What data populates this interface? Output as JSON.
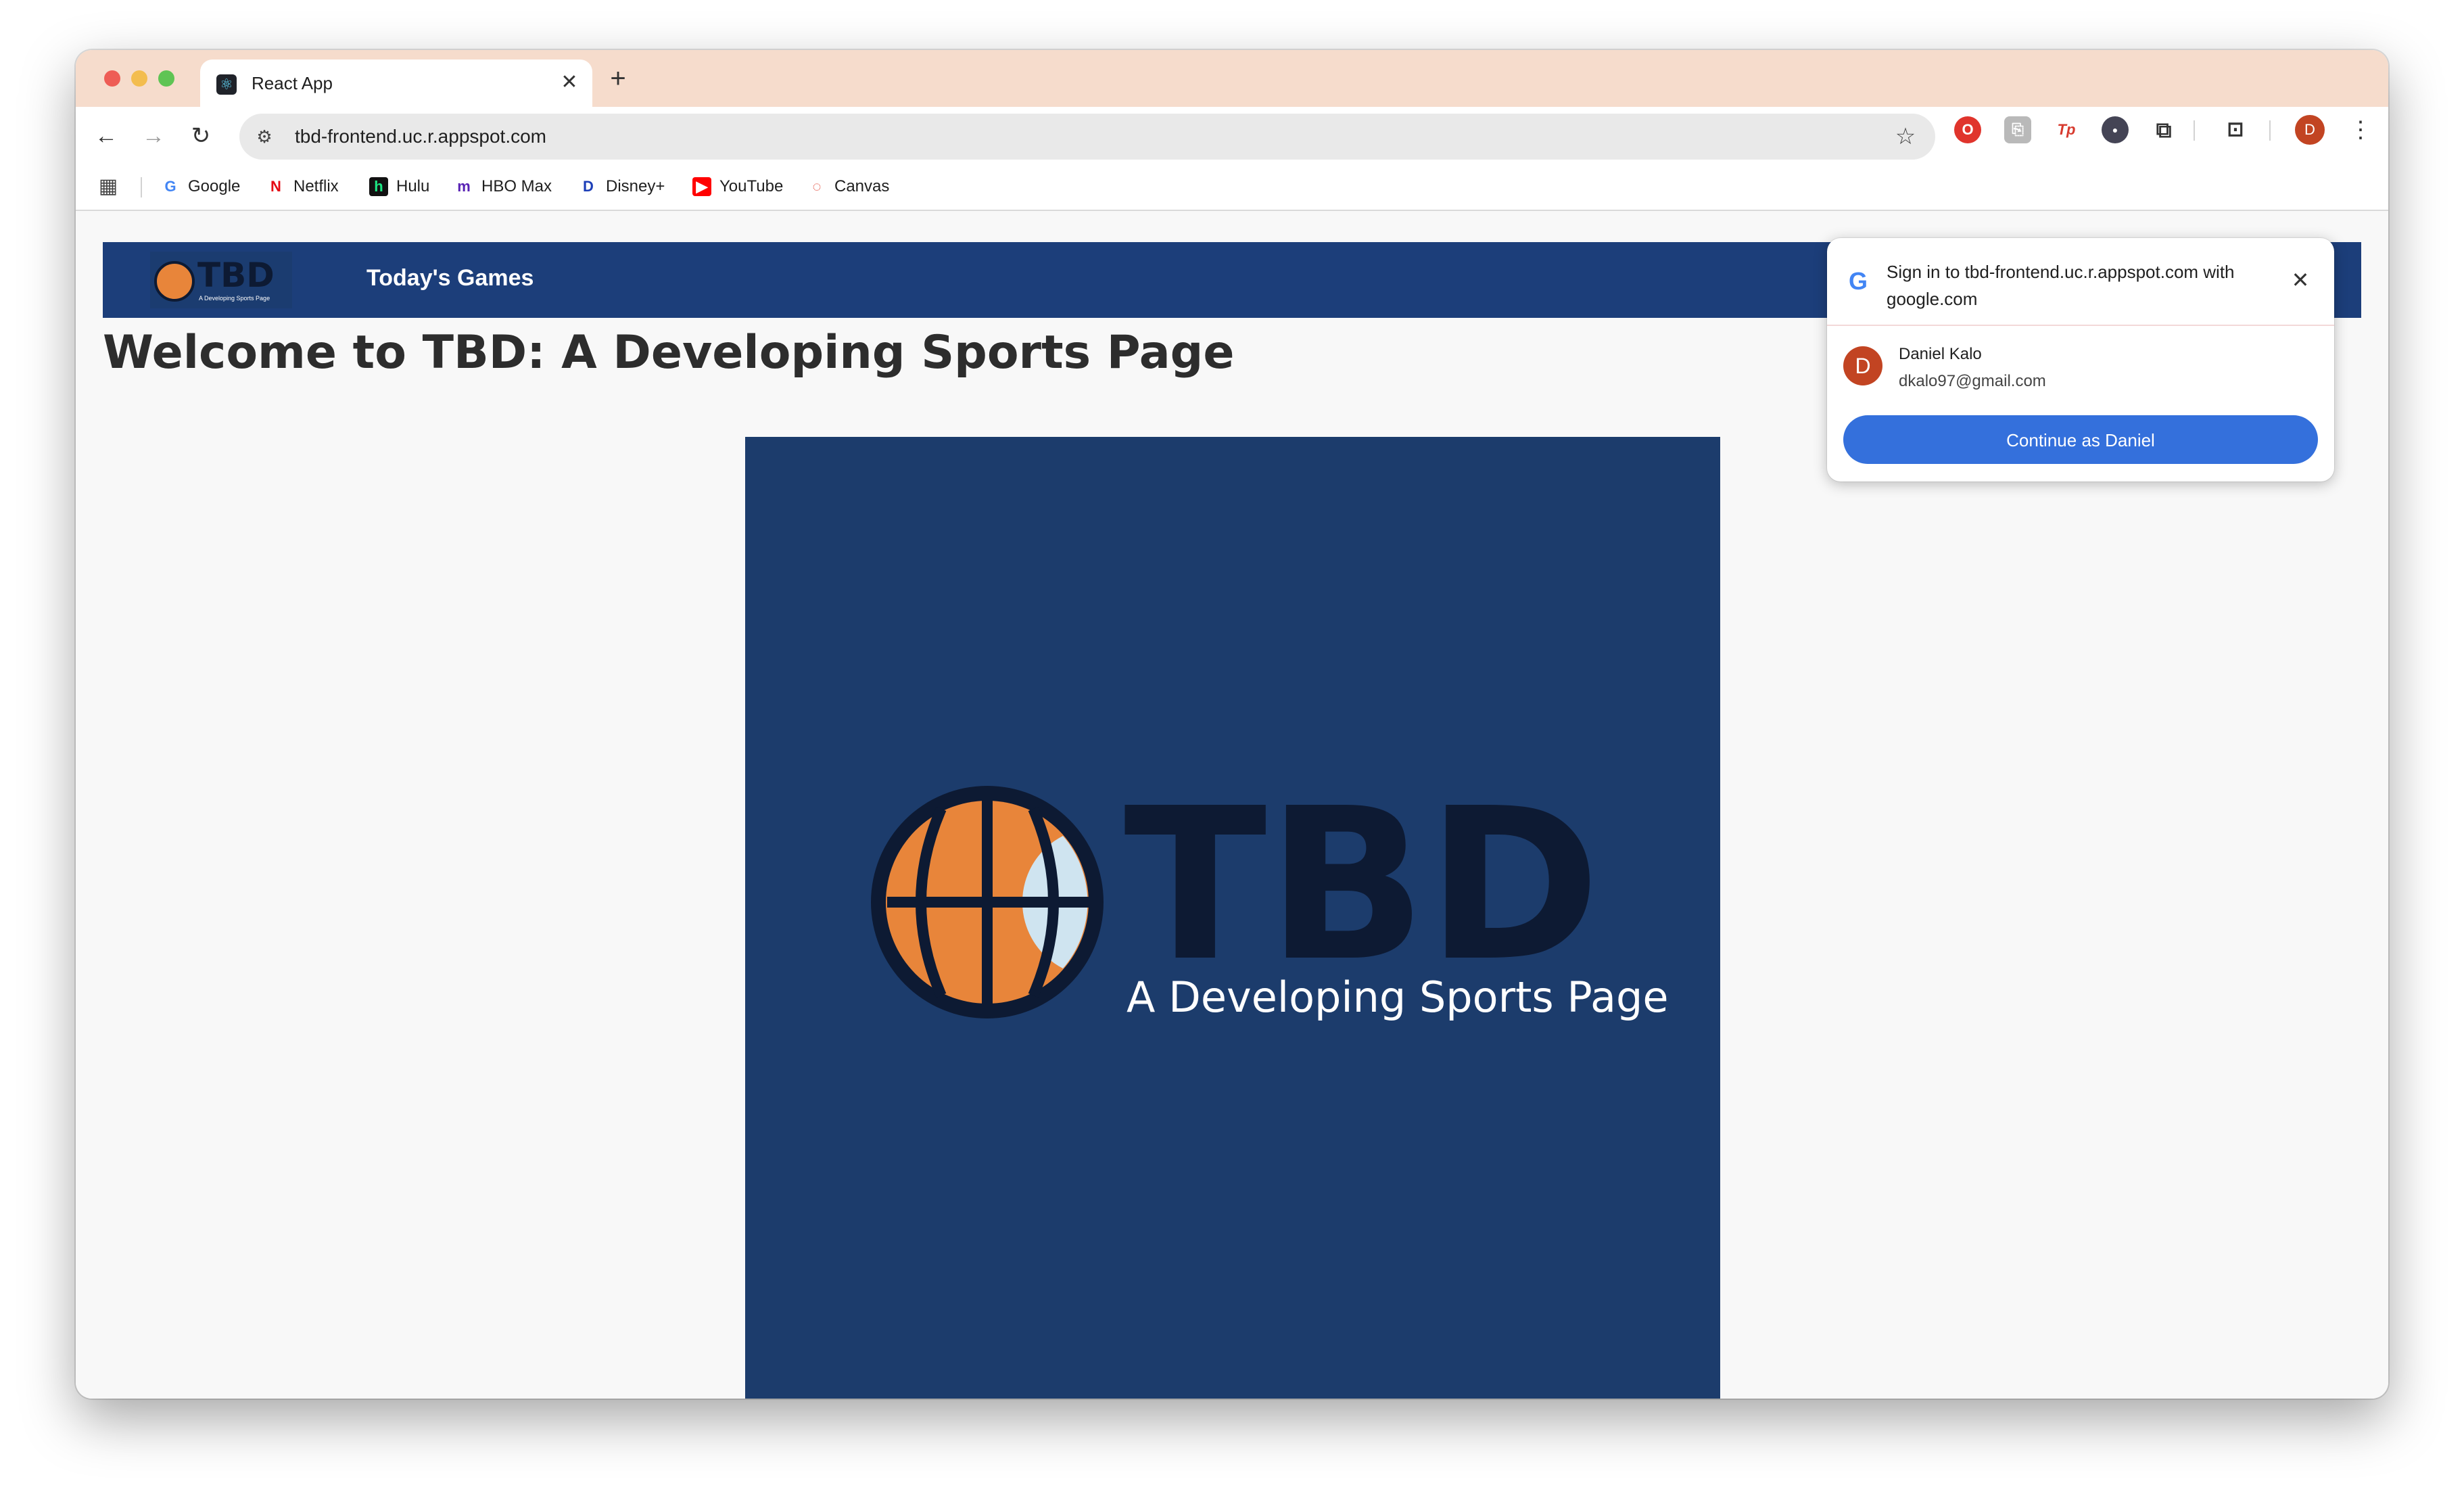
{
  "browser": {
    "tab": {
      "title": "React App",
      "close_glyph": "✕"
    },
    "new_tab_glyph": "+",
    "nav": {
      "back": "←",
      "forward": "→",
      "reload": "↻"
    },
    "address": {
      "url": "tbd-frontend.uc.r.appspot.com",
      "site_info_glyph": "⚙",
      "star_glyph": "☆"
    },
    "extensions": [
      {
        "name": "opera-extension-icon",
        "glyph": "O"
      },
      {
        "name": "gray-extension-icon",
        "glyph": "⎘"
      },
      {
        "name": "tp-extension-icon",
        "glyph": "Tp"
      },
      {
        "name": "circle-extension-icon",
        "glyph": "●"
      },
      {
        "name": "puzzle-extension-icon",
        "glyph": "⧉"
      },
      {
        "name": "tab-search-icon",
        "glyph": "⊡"
      }
    ],
    "profile_initial": "D",
    "menu_glyph": "⋮",
    "apps_glyph": "▦",
    "bookmarks": [
      {
        "label": "Google",
        "icon": "G",
        "color": "#4285f4",
        "bg": "transparent"
      },
      {
        "label": "Netflix",
        "icon": "N",
        "color": "#e50914",
        "bg": "transparent"
      },
      {
        "label": "Hulu",
        "icon": "h",
        "color": "#1ce783",
        "bg": "#111111"
      },
      {
        "label": "HBO Max",
        "icon": "m",
        "color": "#5822b4",
        "bg": "transparent"
      },
      {
        "label": "Disney+",
        "icon": "D",
        "color": "#1d3fb8",
        "bg": "transparent"
      },
      {
        "label": "YouTube",
        "icon": "▶",
        "color": "#ffffff",
        "bg": "#ff0000"
      },
      {
        "label": "Canvas",
        "icon": "◌",
        "color": "#e03e2d",
        "bg": "transparent"
      }
    ]
  },
  "site": {
    "logo": {
      "title": "TBD",
      "subtitle": "A Developing Sports Page"
    },
    "nav_link": "Today's Games",
    "heading": "Welcome to TBD: A Developing Sports Page",
    "hero": {
      "title": "TBD",
      "subtitle": "A Developing Sports Page"
    }
  },
  "signin": {
    "title": "Sign in to tbd-frontend.uc.r.appspot.com with google.com",
    "g_glyph": "G",
    "close_glyph": "✕",
    "account": {
      "initial": "D",
      "name": "Daniel Kalo",
      "email": "dkalo97@gmail.com"
    },
    "button": "Continue as Daniel"
  },
  "colors": {
    "titlebar": "#f6dccc",
    "site_nav": "#1c3e7a",
    "hero_bg": "#1c3c6c",
    "ball_orange": "#e8853a",
    "ball_light": "#cfe4f0",
    "logo_dark": "#0d1a33",
    "button_blue": "#3470dc"
  }
}
